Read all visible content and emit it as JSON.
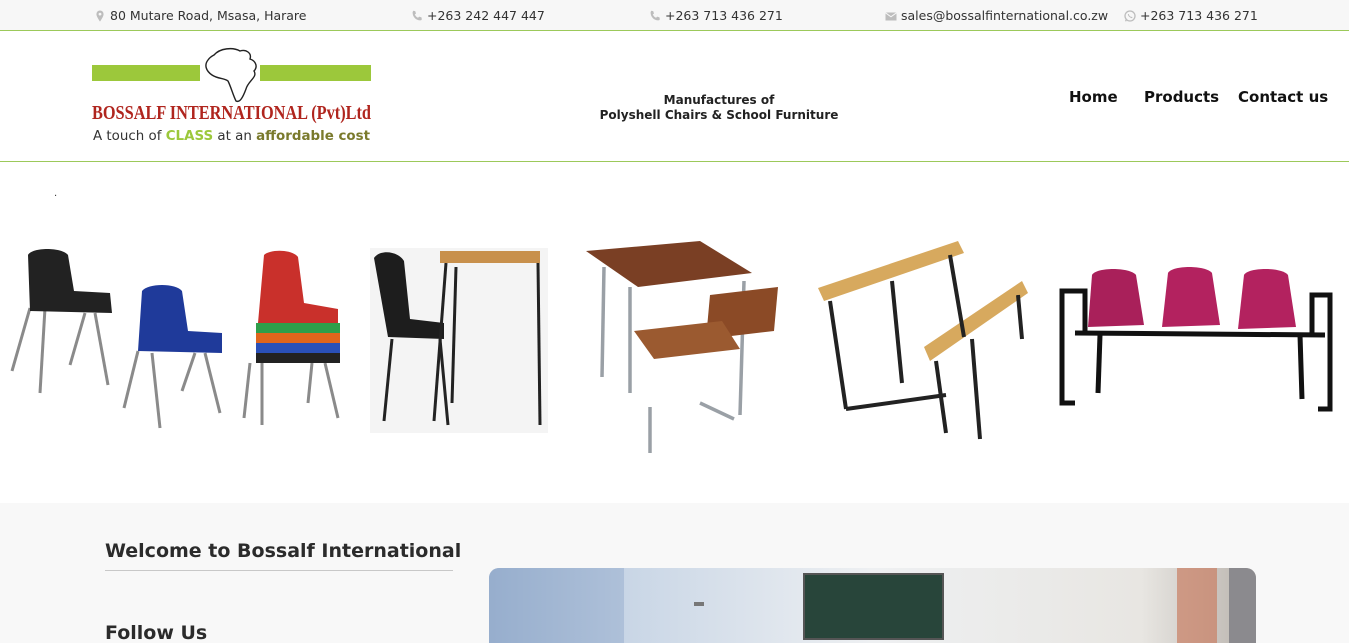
{
  "topbar": {
    "address": {
      "icon": "map-pin-icon",
      "text": "80 Mutare Road, Msasa, Harare"
    },
    "landline": {
      "icon": "phone-icon",
      "text": "+263 242 447 447"
    },
    "mobile": {
      "icon": "phone-icon",
      "text": "+263 713 436 271"
    },
    "email": {
      "icon": "envelope-icon",
      "text": "sales@bossalfinternational.co.zw"
    },
    "whatsapp": {
      "icon": "whatsapp-icon",
      "text": "+263 713 436 271"
    }
  },
  "header": {
    "logo": {
      "name": "BOSSALF INTERNATIONAL (Pvt)Ltd",
      "slogan_prefix": "A touch of ",
      "slogan_class": "CLASS",
      "slogan_middle": " at an ",
      "slogan_affordable": "affordable cost"
    },
    "tagline_line1": "Manufactures of",
    "tagline_line2": "Polyshell Chairs & School Furniture",
    "nav": [
      {
        "label": "Home"
      },
      {
        "label": "Products"
      },
      {
        "label": "Contact us"
      }
    ]
  },
  "products": {
    "marker": "."
  },
  "main": {
    "welcome_title": "Welcome to Bossalf International",
    "follow_title": "Follow Us"
  },
  "colors": {
    "brand_green": "#9cc83b",
    "brand_red": "#b0251e",
    "slogan_olive": "#7a7a2c",
    "accent_rule": "#9cc95a"
  }
}
